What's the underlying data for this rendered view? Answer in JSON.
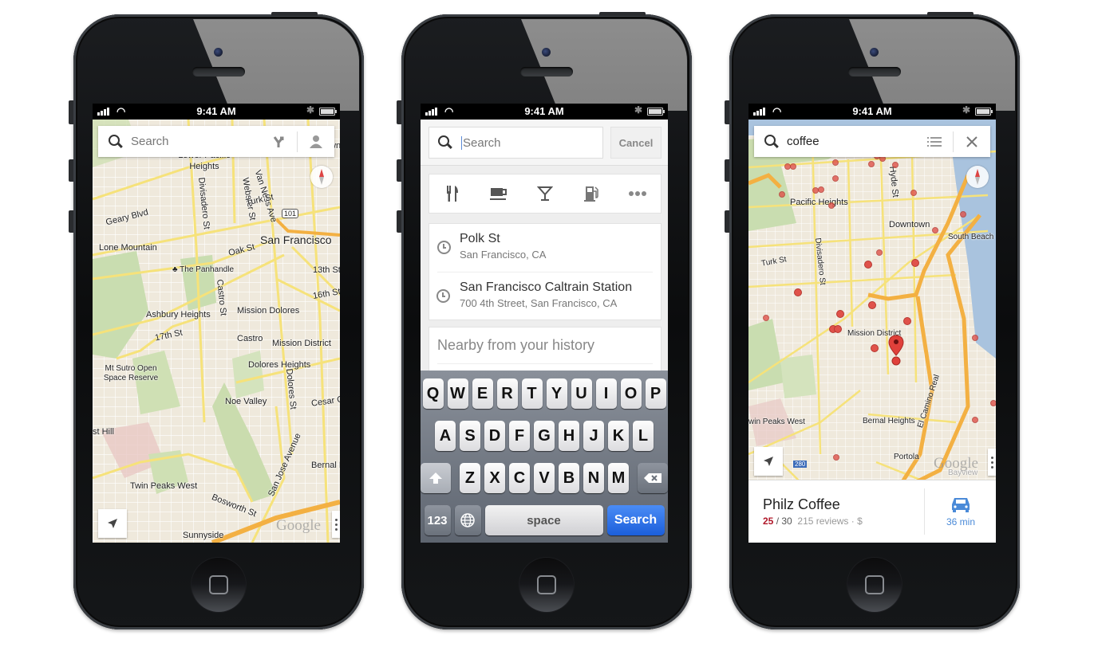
{
  "status_bar": {
    "time": "9:41 AM"
  },
  "phones": [
    {
      "id": "map-browse",
      "search": {
        "placeholder": "Search",
        "icons": [
          "search-icon",
          "directions-icon",
          "profile-icon"
        ]
      },
      "map_labels": {
        "downtown": "Downt",
        "lower_pacific_heights": "Lower Pacific Heights",
        "van_ness": "Van Ness Ave",
        "geary": "Geary Blvd",
        "divisadero": "Divisadero St",
        "webster": "Webster St",
        "turk": "Turk St",
        "hwy101": "101",
        "san_francisco": "San Francisco",
        "lone_mountain": "Lone Mountain",
        "oak": "Oak St",
        "panhandle": "The Panhandle",
        "st13": "13th St",
        "castro_st": "Castro St",
        "st16": "16th St",
        "ashbury": "Ashbury Heights",
        "mission_dolores": "Mission Dolores",
        "st17": "17th St",
        "castro": "Castro",
        "mission_district": "Mission District",
        "sutro": "Mt Sutro Open Space Reserve",
        "dolores_heights": "Dolores Heights",
        "noe_valley": "Noe Valley",
        "dolores_st": "Dolores St",
        "cesar": "Cesar C",
        "forest_hill": "st Hill",
        "san_jose": "San Jose Avenue",
        "bernal": "Bernal H",
        "twin_peaks_west": "Twin Peaks West",
        "bosworth": "Bosworth St",
        "sunnyside": "Sunnyside"
      },
      "google_logo": "Google"
    },
    {
      "id": "search-suggestions",
      "search": {
        "placeholder": "Search",
        "cancel_label": "Cancel"
      },
      "categories": [
        {
          "name": "restaurants",
          "icon": "fork-knife-icon"
        },
        {
          "name": "coffee",
          "icon": "coffee-cup-icon"
        },
        {
          "name": "bars",
          "icon": "cocktail-icon"
        },
        {
          "name": "gas",
          "icon": "gas-pump-icon"
        },
        {
          "name": "more",
          "icon": "more-dots-icon"
        }
      ],
      "recent": [
        {
          "title": "Polk St",
          "subtitle": "San Francisco, CA"
        },
        {
          "title": "San Francisco Caltrain Station",
          "subtitle": "700 4th Street, San Francisco, CA"
        }
      ],
      "nearby_label": "Nearby from your history",
      "keyboard": {
        "row1": [
          "Q",
          "W",
          "E",
          "R",
          "T",
          "Y",
          "U",
          "I",
          "O",
          "P"
        ],
        "row2": [
          "A",
          "S",
          "D",
          "F",
          "G",
          "H",
          "J",
          "K",
          "L"
        ],
        "row3": [
          "Z",
          "X",
          "C",
          "V",
          "B",
          "N",
          "M"
        ],
        "numbers_label": "123",
        "space_label": "space",
        "action_label": "Search"
      }
    },
    {
      "id": "coffee-results",
      "search": {
        "value": "coffee"
      },
      "map_labels": {
        "hyde": "Hyde St",
        "pacific_heights": "Pacific Heights",
        "downtown": "Downtown",
        "south_beach": "South Beach",
        "turk": "Turk St",
        "divisadero": "Divisadero St",
        "mission_district": "Mission District",
        "el_camino": "El Camino Real",
        "twin_peaks_west": "win Peaks West",
        "bernal": "Bernal Heights",
        "portola": "Portola",
        "hwy280": "280",
        "bayview": "Bayview"
      },
      "google_logo": "Google",
      "result": {
        "name": "Philz Coffee",
        "score": "25",
        "score_max": "/ 30",
        "reviews": "215 reviews · $",
        "drive_time": "36 min"
      }
    }
  ]
}
